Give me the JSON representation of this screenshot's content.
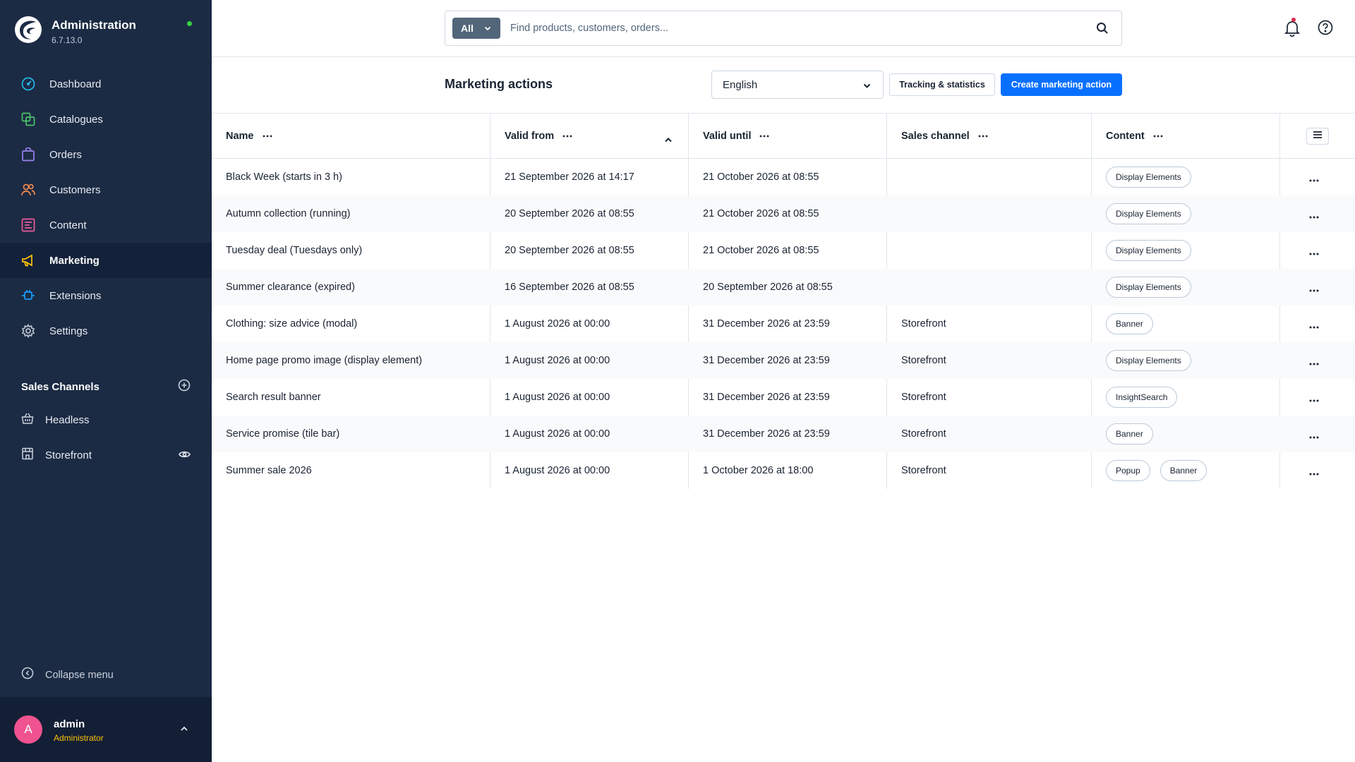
{
  "app": {
    "title": "Administration",
    "version": "6.7.13.0"
  },
  "colors": {
    "sidebar_bg": "#1c2b44",
    "primary": "#0870ff",
    "status_online": "#37d046",
    "notification_dot": "#de294c",
    "avatar": "#ef5390",
    "role": "#ffc20a"
  },
  "nav": {
    "items": [
      {
        "label": "Dashboard",
        "icon": "gauge-icon"
      },
      {
        "label": "Catalogues",
        "icon": "products-icon"
      },
      {
        "label": "Orders",
        "icon": "shopping-bag-icon"
      },
      {
        "label": "Customers",
        "icon": "users-icon"
      },
      {
        "label": "Content",
        "icon": "content-icon"
      },
      {
        "label": "Marketing",
        "icon": "megaphone-icon",
        "active": true
      },
      {
        "label": "Extensions",
        "icon": "plug-icon"
      },
      {
        "label": "Settings",
        "icon": "gear-icon"
      }
    ]
  },
  "sales_channels": {
    "title": "Sales Channels",
    "items": [
      {
        "label": "Headless",
        "icon": "basket-icon"
      },
      {
        "label": "Storefront",
        "icon": "storefront-icon"
      }
    ]
  },
  "sidebar_footer": {
    "collapse_label": "Collapse menu",
    "user_initial": "A",
    "user_name": "admin",
    "user_role": "Administrator"
  },
  "search": {
    "type_label": "All",
    "placeholder": "Find products, customers, orders..."
  },
  "page": {
    "title": "Marketing actions",
    "language": "English",
    "tracking_button": "Tracking & statistics",
    "create_button": "Create marketing action"
  },
  "grid": {
    "columns": [
      "Name",
      "Valid from",
      "Valid until",
      "Sales channel",
      "Content"
    ],
    "rows": [
      {
        "name": "Black Week (starts in 3 h)",
        "valid_from": "21 September 2026 at 14:17",
        "valid_until": "21 October 2026 at 08:55",
        "sales_channel": "",
        "content": [
          "Display Elements"
        ]
      },
      {
        "name": "Autumn collection (running)",
        "valid_from": "20 September 2026 at 08:55",
        "valid_until": "21 October 2026 at 08:55",
        "sales_channel": "",
        "content": [
          "Display Elements"
        ]
      },
      {
        "name": "Tuesday deal (Tuesdays only)",
        "valid_from": "20 September 2026 at 08:55",
        "valid_until": "21 October 2026 at 08:55",
        "sales_channel": "",
        "content": [
          "Display Elements"
        ]
      },
      {
        "name": "Summer clearance (expired)",
        "valid_from": "16 September 2026 at 08:55",
        "valid_until": "20 September 2026 at 08:55",
        "sales_channel": "",
        "content": [
          "Display Elements"
        ]
      },
      {
        "name": "Clothing: size advice (modal)",
        "valid_from": "1 August 2026 at 00:00",
        "valid_until": "31 December 2026 at 23:59",
        "sales_channel": "Storefront",
        "content": [
          "Banner"
        ]
      },
      {
        "name": "Home page promo image (display element)",
        "valid_from": "1 August 2026 at 00:00",
        "valid_until": "31 December 2026 at 23:59",
        "sales_channel": "Storefront",
        "content": [
          "Display Elements"
        ]
      },
      {
        "name": "Search result banner",
        "valid_from": "1 August 2026 at 00:00",
        "valid_until": "31 December 2026 at 23:59",
        "sales_channel": "Storefront",
        "content": [
          "InsightSearch"
        ]
      },
      {
        "name": "Service promise (tile bar)",
        "valid_from": "1 August 2026 at 00:00",
        "valid_until": "31 December 2026 at 23:59",
        "sales_channel": "Storefront",
        "content": [
          "Banner"
        ]
      },
      {
        "name": "Summer sale 2026",
        "valid_from": "1 August 2026 at 00:00",
        "valid_until": "1 October 2026 at 18:00",
        "sales_channel": "Storefront",
        "content": [
          "Popup",
          "Banner"
        ]
      }
    ]
  }
}
